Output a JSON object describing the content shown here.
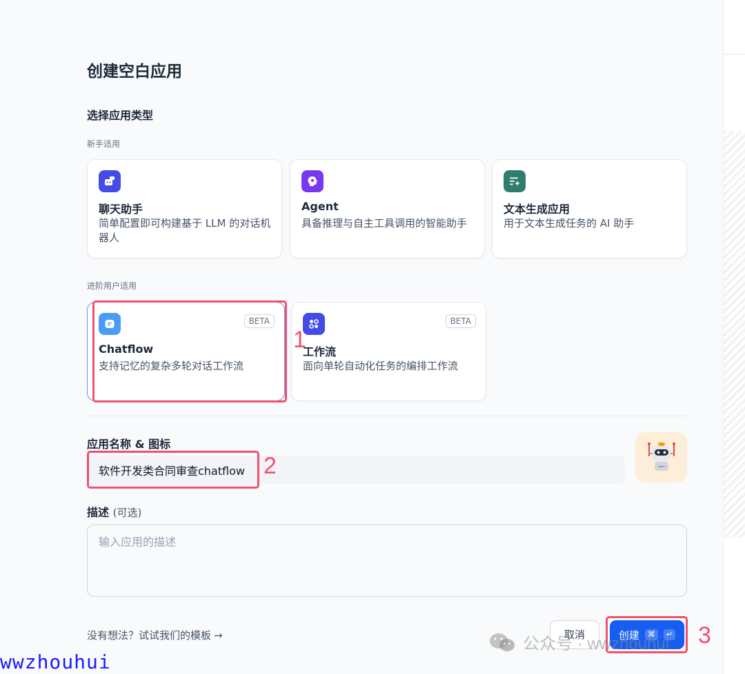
{
  "dialog": {
    "title": "创建空白应用",
    "section_title": "选择应用类型",
    "beginner_group": {
      "label": "新手适用",
      "cards": [
        {
          "name": "聊天助手",
          "desc": "简单配置即可构建基于 LLM 的对话机器人",
          "icon": "chat-bot-icon",
          "color": "#444ce7"
        },
        {
          "name": "Agent",
          "desc": "具备推理与自主工具调用的智能助手",
          "icon": "agent-icon",
          "color": "#7839ee"
        },
        {
          "name": "文本生成应用",
          "desc": "用于文本生成任务的 AI 助手",
          "icon": "text-generation-icon",
          "color": "#2f7d6e"
        }
      ]
    },
    "advanced_group": {
      "label": "进阶用户适用",
      "cards": [
        {
          "name": "Chatflow",
          "desc": "支持记忆的复杂多轮对话工作流",
          "badge": "BETA",
          "icon": "chatflow-icon",
          "color": "#4a9df4",
          "selected": true
        },
        {
          "name": "工作流",
          "desc": "面向单轮自动化任务的编排工作流",
          "badge": "BETA",
          "icon": "workflow-icon",
          "color": "#444ce7"
        }
      ]
    },
    "name_field": {
      "label": "应用名称 & 图标",
      "value": "软件开发类合同审查chatflow"
    },
    "app_icon": {
      "name": "robot-icon",
      "bg": "#fdeed9"
    },
    "desc_field": {
      "label": "描述",
      "optional": "(可选)",
      "placeholder": "输入应用的描述"
    },
    "template_link": "没有想法？试试我们的模板",
    "template_arrow": "→",
    "cancel_label": "取消",
    "create_label": "创建",
    "shortcut_keys": [
      "⌘",
      "↵"
    ]
  },
  "annotations": {
    "marker_1": "1",
    "marker_2": "2",
    "marker_3": "3",
    "color": "#f0506e"
  },
  "watermark": {
    "text": "公众号 · wwzhouhui",
    "handle": "wwzhouhui"
  }
}
